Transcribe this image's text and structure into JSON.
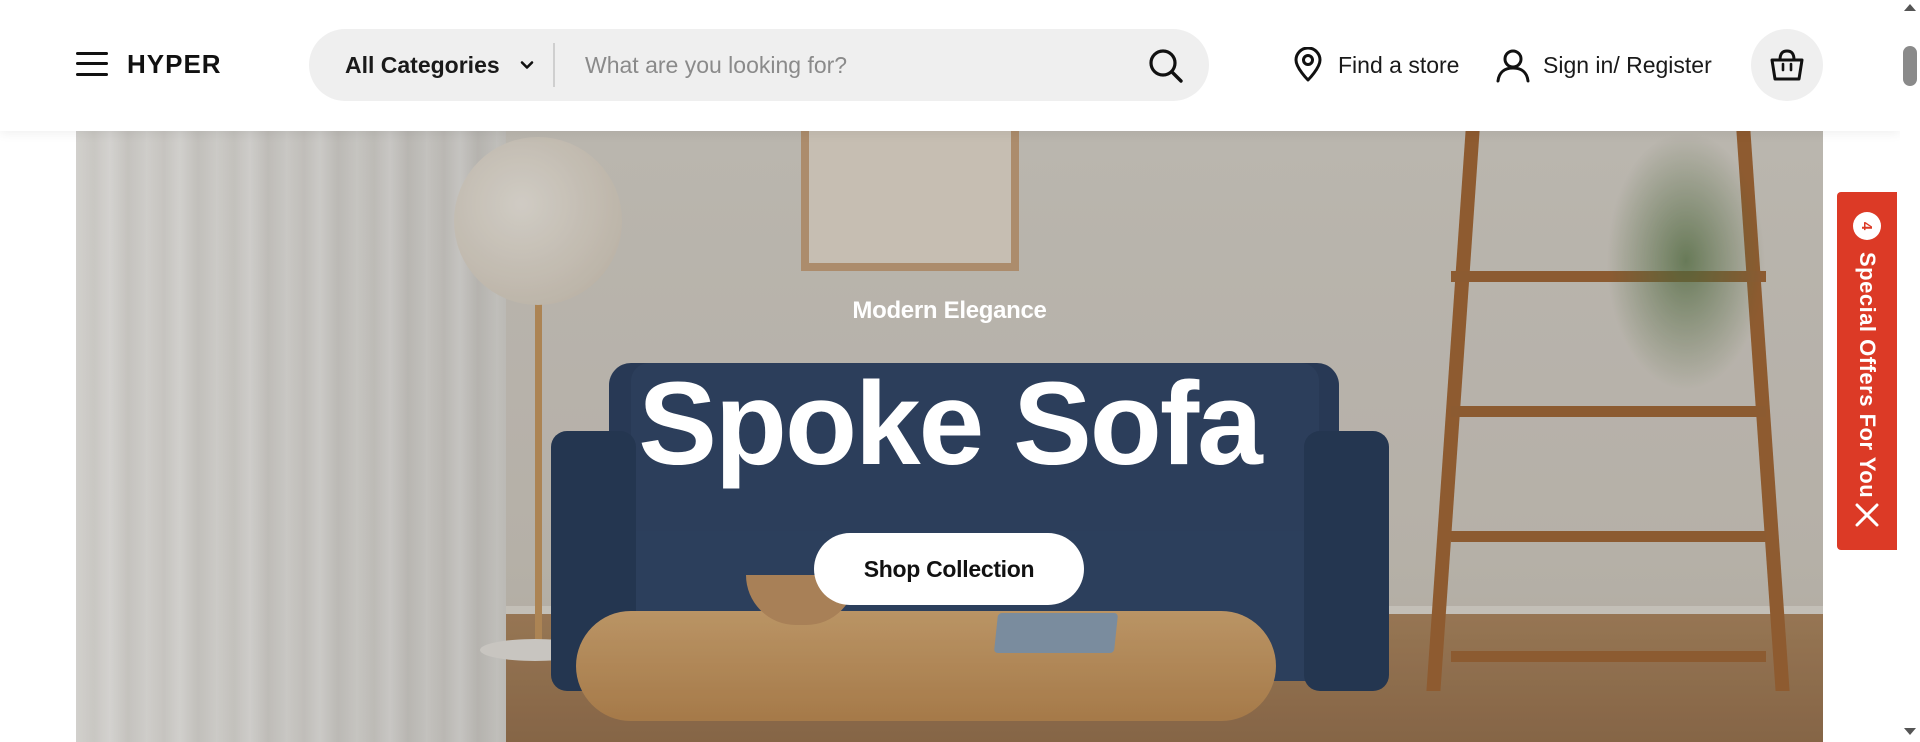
{
  "header": {
    "brand": "HYPER",
    "search": {
      "category_label": "All Categories",
      "placeholder": "What are you looking for?"
    },
    "find_store_label": "Find a store",
    "sign_in_label": "Sign in/ Register",
    "icons": {
      "menu": "hamburger-icon",
      "chevron": "chevron-down-icon",
      "search": "search-icon",
      "location": "location-pin-icon",
      "user": "user-icon",
      "cart": "shopping-bag-icon"
    }
  },
  "hero": {
    "eyebrow": "Modern Elegance",
    "title": "Spoke Sofa",
    "cta_label": "Shop Collection"
  },
  "offers_tab": {
    "count": "4",
    "label": "Special Offers For You",
    "color": "#dc3a26",
    "close_icon": "close-icon"
  }
}
